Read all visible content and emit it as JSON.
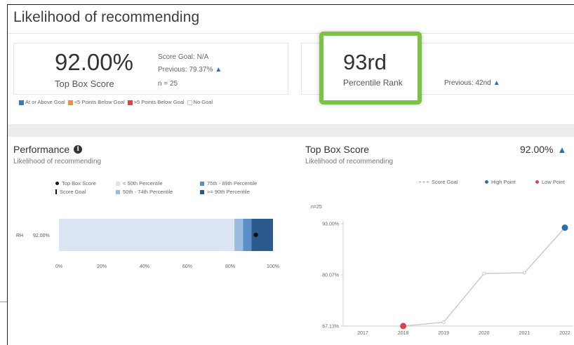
{
  "header": {
    "title": "Likelihood of recommending"
  },
  "score_card": {
    "value": "92.00%",
    "label": "Top Box Score",
    "goal": "Score Goal: N/A",
    "previous": "Previous: 79.37%",
    "n": "n = 25"
  },
  "goal_legend": [
    {
      "label": "At or Above Goal",
      "color": "#3c7abd"
    },
    {
      "label": "<5 Points Below Goal",
      "color": "#f08a4b"
    },
    {
      "label": ">5 Points Below Goal",
      "color": "#d9434a"
    },
    {
      "label": "No Goal",
      "color": "#ffffff"
    }
  ],
  "rank_card": {
    "value": "93rd",
    "label": "Percentile Rank",
    "previous": "Previous: 42nd"
  },
  "performance": {
    "title": "Performance",
    "subtitle": "Likelihood of recommending",
    "legend": {
      "top_box": "Top Box Score",
      "score_goal": "Score Goal",
      "p_lt50": "< 50th Percentile",
      "p_50_74": "50th - 74th Percentile",
      "p_75_89": "75th - 89th Percentile",
      "p_gte90": ">= 90th Percentile"
    },
    "row_label": "RH",
    "row_value": "92.00%"
  },
  "top_box_panel": {
    "title": "Top Box Score",
    "value": "92.00%",
    "subtitle": "Likelihood of recommending",
    "legend": {
      "score_goal": "Score Goal",
      "high_point": "High Point",
      "low_point": "Low Point"
    },
    "n_label": "n=25"
  },
  "chart_data": [
    {
      "type": "bar",
      "orientation": "horizontal",
      "categories": [
        "RH"
      ],
      "bands": [
        {
          "name": "< 50th Percentile",
          "from": 0,
          "to": 82,
          "color": "#dbe5f1"
        },
        {
          "name": "50th - 74th Percentile",
          "from": 82,
          "to": 86,
          "color": "#9bbbe0"
        },
        {
          "name": "75th - 89th Percentile",
          "from": 86,
          "to": 90,
          "color": "#5a8fc7"
        },
        {
          "name": ">= 90th Percentile",
          "from": 90,
          "to": 100,
          "color": "#2c5a8c"
        }
      ],
      "marker": {
        "name": "Top Box Score",
        "value": 92.0
      },
      "xlim": [
        0,
        100
      ],
      "xticks": [
        "0%",
        "20%",
        "40%",
        "60%",
        "80%",
        "100%"
      ]
    },
    {
      "type": "line",
      "x": [
        "2017",
        "2018",
        "2019",
        "2020",
        "2021",
        "2022"
      ],
      "values": [
        null,
        67.15,
        68.1,
        80.4,
        80.6,
        92.0
      ],
      "ylim": [
        67.13,
        93.0
      ],
      "yticks": [
        "93.00%",
        "80.07%",
        "67.13%"
      ],
      "high_point": {
        "x": "2022",
        "value": 92.0,
        "color": "#2d6db0"
      },
      "low_point": {
        "x": "2018",
        "value": 67.15,
        "color": "#d9434a"
      },
      "line_color": "#c8c8c8"
    }
  ]
}
